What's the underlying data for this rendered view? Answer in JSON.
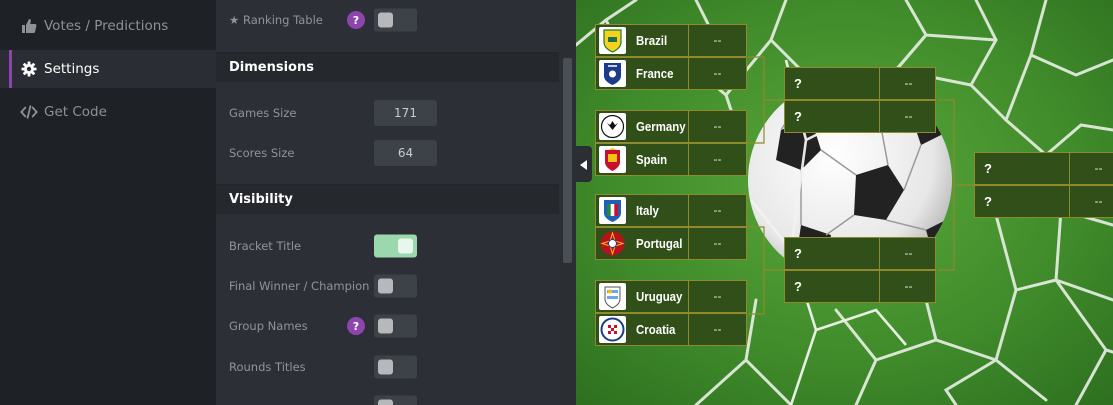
{
  "nav": {
    "items": [
      {
        "label": "Votes / Predictions",
        "icon": "thumbs-up-icon",
        "active": false
      },
      {
        "label": "Settings",
        "icon": "gear-icon",
        "active": true
      },
      {
        "label": "Get Code",
        "icon": "code-icon",
        "active": false
      }
    ]
  },
  "settings": {
    "ranking_table": {
      "label": "Ranking Table",
      "help": "?",
      "enabled": false,
      "icon": "star-icon"
    },
    "dimensions": {
      "title": "Dimensions",
      "games_size": {
        "label": "Games Size",
        "value": "171"
      },
      "scores_size": {
        "label": "Scores Size",
        "value": "64"
      }
    },
    "visibility": {
      "title": "Visibility",
      "bracket_title": {
        "label": "Bracket Title",
        "enabled": true
      },
      "final_winner": {
        "label": "Final Winner / Champion",
        "enabled": false
      },
      "group_names": {
        "label": "Group Names",
        "help": "?",
        "enabled": false
      },
      "rounds_titles": {
        "label": "Rounds Titles",
        "enabled": false
      }
    }
  },
  "bracket": {
    "round1": [
      {
        "team": "Brazil",
        "score": "--",
        "flag": "brazil-crest-icon"
      },
      {
        "team": "France",
        "score": "--",
        "flag": "france-crest-icon"
      },
      {
        "team": "Germany",
        "score": "--",
        "flag": "germany-crest-icon"
      },
      {
        "team": "Spain",
        "score": "--",
        "flag": "spain-crest-icon"
      },
      {
        "team": "Italy",
        "score": "--",
        "flag": "italy-crest-icon"
      },
      {
        "team": "Portugal",
        "score": "--",
        "flag": "portugal-crest-icon"
      },
      {
        "team": "Uruguay",
        "score": "--",
        "flag": "uruguay-crest-icon"
      },
      {
        "team": "Croatia",
        "score": "--",
        "flag": "croatia-crest-icon"
      }
    ],
    "round2": [
      {
        "team": "?",
        "score": "--"
      },
      {
        "team": "?",
        "score": "--"
      },
      {
        "team": "?",
        "score": "--"
      },
      {
        "team": "?",
        "score": "--"
      }
    ],
    "round3": [
      {
        "team": "?",
        "score": "--"
      },
      {
        "team": "?",
        "score": "--"
      }
    ]
  },
  "colors": {
    "accent": "#8e44ad",
    "cell_bg": "#314f19",
    "cell_border": "#8f8a2d",
    "toggle_on": "#9bd8ad"
  }
}
